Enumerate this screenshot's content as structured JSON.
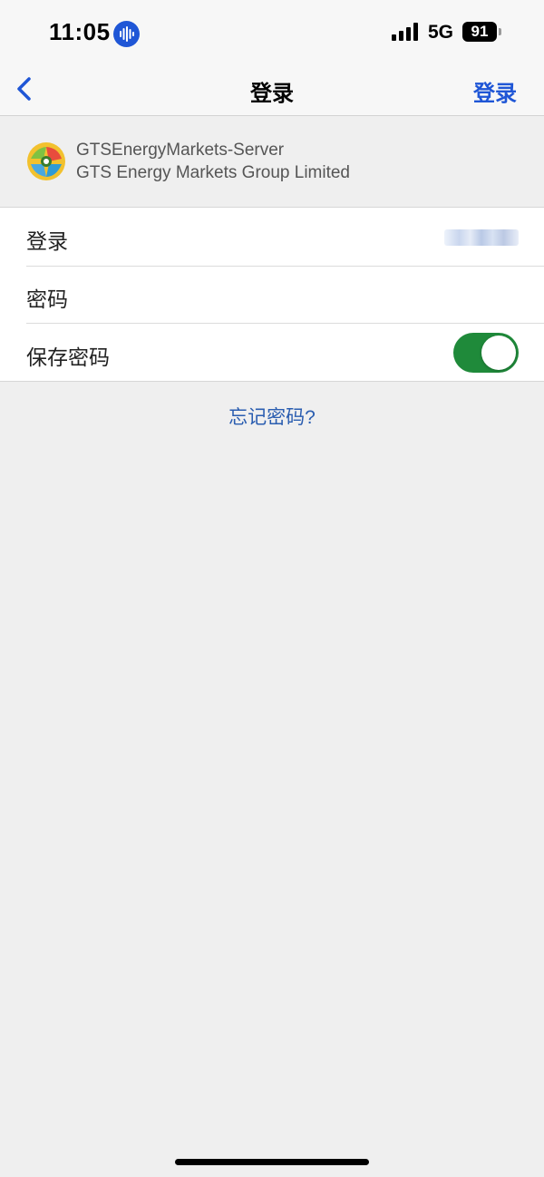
{
  "status_bar": {
    "time": "11:05",
    "voice_icon": "voice-waveform-icon",
    "signal_icon": "cellular-signal-icon",
    "network": "5G",
    "battery": "91"
  },
  "nav": {
    "back_icon": "chevron-left-icon",
    "title": "登录",
    "action_label": "登录",
    "accent_color": "#1f56d6"
  },
  "server": {
    "logo_icon": "metatrader-logo-icon",
    "name": "GTSEnergyMarkets-Server",
    "company": "GTS Energy Markets Group Limited"
  },
  "form": {
    "login_label": "登录",
    "password_label": "密码",
    "save_password_label": "保存密码",
    "save_password_enabled": true,
    "toggle_color": "#1f8a3a"
  },
  "forgot_password_link": "忘记密码?"
}
